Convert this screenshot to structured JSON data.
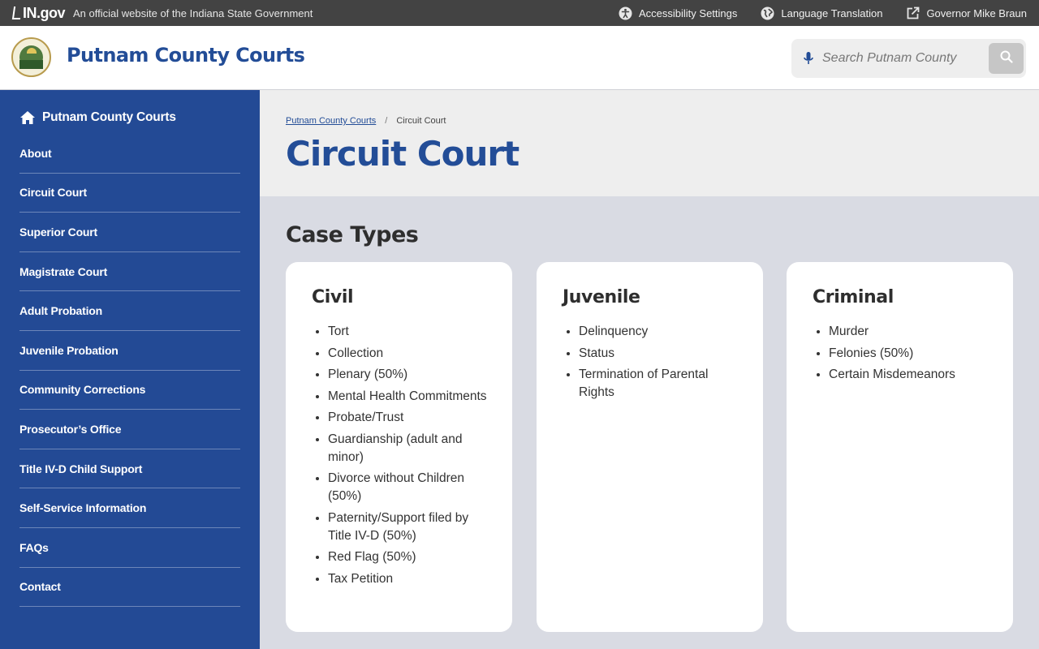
{
  "topbar": {
    "logo_text": "IN.gov",
    "official_text": "An official website of the Indiana State Government",
    "links": [
      {
        "label": "Accessibility Settings",
        "icon": "accessibility-icon"
      },
      {
        "label": "Language Translation",
        "icon": "globe-icon"
      },
      {
        "label": "Governor Mike Braun",
        "icon": "external-link-icon"
      }
    ]
  },
  "header": {
    "seal_icon": "county-seal-icon",
    "site_title": "Putnam County Courts",
    "search": {
      "placeholder": "Search Putnam County",
      "mic_icon": "microphone-icon",
      "button_icon": "search-icon"
    }
  },
  "sidebar": {
    "home_label": "Putnam County Courts",
    "home_icon": "home-icon",
    "items": [
      "About",
      "Circuit Court",
      "Superior Court",
      "Magistrate Court",
      "Adult Probation",
      "Juvenile Probation",
      "Community Corrections",
      "Prosecutor’s Office",
      "Title IV-D Child Support",
      "Self-Service Information",
      "FAQs",
      "Contact"
    ]
  },
  "breadcrumb": {
    "parent": "Putnam County Courts",
    "separator": "/",
    "current": "Circuit Court"
  },
  "page_title": "Circuit Court",
  "section_heading": "Case Types",
  "cards": [
    {
      "title": "Civil",
      "items": [
        "Tort",
        "Collection",
        "Plenary (50%)",
        "Mental Health Commitments",
        "Probate/Trust",
        "Guardianship (adult and minor)",
        "Divorce without Children (50%)",
        "Paternity/Support filed by Title IV-D (50%)",
        "Red Flag (50%)",
        "Tax Petition"
      ]
    },
    {
      "title": "Juvenile",
      "items": [
        "Delinquency",
        "Status",
        "Termination of Parental Rights"
      ]
    },
    {
      "title": "Criminal",
      "items": [
        "Murder",
        "Felonies (50%)",
        "Certain Misdemeanors"
      ]
    }
  ],
  "colors": {
    "brand_blue": "#234d97",
    "sidebar_blue": "#234a95",
    "topbar": "#434343",
    "content_bg": "#d9dbe3"
  }
}
